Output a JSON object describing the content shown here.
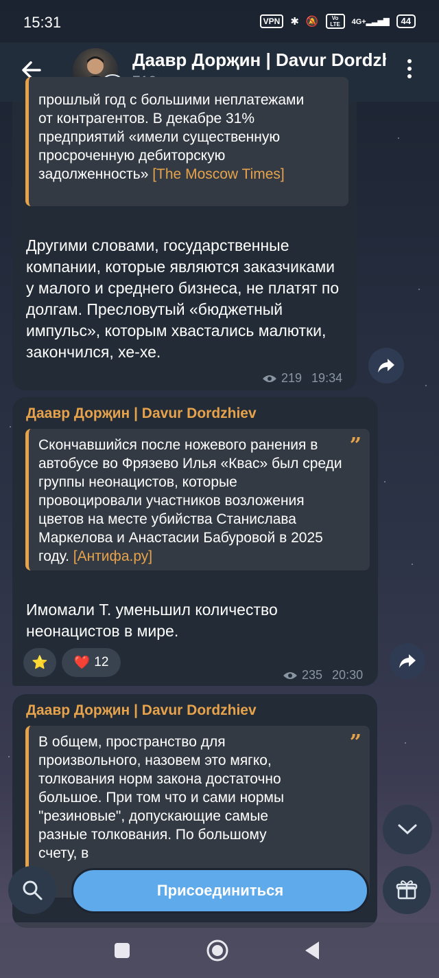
{
  "status_bar": {
    "time": "15:31",
    "vpn": "VPN",
    "signal": "4G+",
    "volte": "Vo LTE",
    "battery": "44"
  },
  "header": {
    "channel_name": "Даавр Дорҗин | Davur Dordzhiev",
    "subscribers": "712 подписчиков",
    "avatar_badge": "2н"
  },
  "messages": [
    {
      "quote_text": "прошлый год с большими неплатежами от контрагентов. В декабре 31% предприятий «имели существенную просроченную дебиторскую задолженность»",
      "quote_source": "[The Moscow Times]",
      "text": "Другими словами, государственные компании, которые являются заказчиками у малого и среднего бизнеса, не платят по долгам. Пресловутый «бюджетный импульс», которым хвастались малютки, закончился, хе-хе.",
      "views": "219",
      "time": "19:34"
    },
    {
      "author": "Даавр Дорҗин | Davur Dordzhiev",
      "quote_text": "Скончавшийся после ножевого ранения в автобусе во Фрязево Илья «Квас» был среди группы неонацистов, которые провоцировали участников возложения цветов на месте убийства Станислава Маркелова и Анастасии Бабуровой в 2025 году.",
      "quote_source": "[Антифа.ру]",
      "text": "Имомали Т. уменьшил количество неонацистов в мире.",
      "reactions": [
        {
          "icon": "star-icon",
          "glyph": "⭐",
          "count": ""
        },
        {
          "icon": "heart-icon",
          "glyph": "❤️",
          "count": "12"
        }
      ],
      "views": "235",
      "time": "20:30"
    },
    {
      "author": "Даавр Дорҗин | Davur Dordzhiev",
      "quote_text": "В общем, пространство для произвольного, назовем это мягко, толкования норм закона достаточно большое. При том что и сами нормы \"резиновые\", допускающие самые разные толкования. По большому счету, в"
    }
  ],
  "bottom_bar": {
    "join_label": "Присоединиться"
  },
  "colors": {
    "accent": "#e7a34b",
    "join_button": "#5eaaea",
    "bubble": "#222b36"
  }
}
